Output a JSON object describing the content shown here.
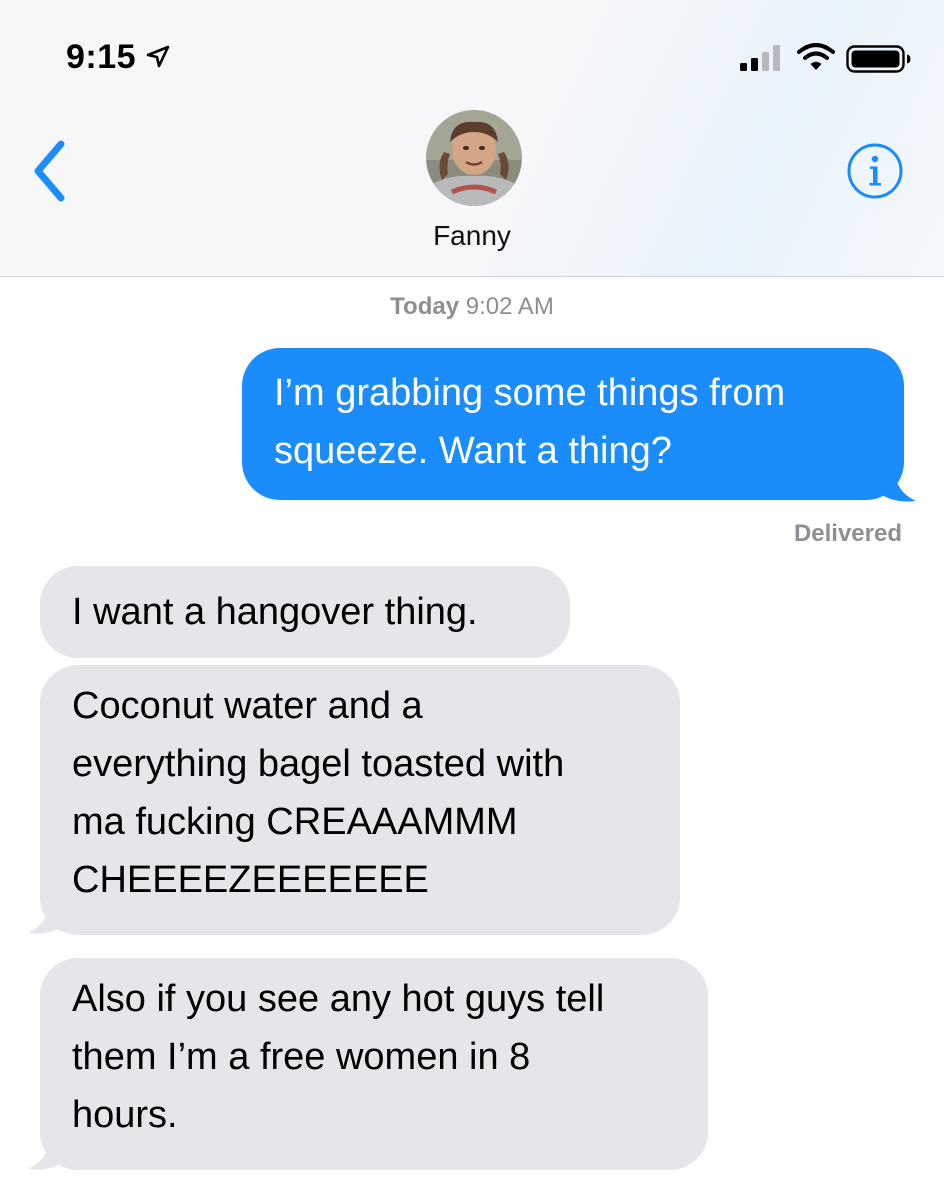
{
  "status_bar": {
    "time": "9:15",
    "location_icon": "location-arrow-icon",
    "signal_icon": "cellular-signal-icon",
    "wifi_icon": "wifi-icon",
    "battery_icon": "battery-icon"
  },
  "nav": {
    "back_icon": "chevron-left-icon",
    "contact_name": "Fanny",
    "avatar_icon": "contact-avatar",
    "info_icon": "info-icon",
    "accent_color": "#1b8cfb"
  },
  "conversation": {
    "timestamp_day": "Today",
    "timestamp_time": "9:02 AM",
    "delivered_label": "Delivered",
    "messages": [
      {
        "direction": "outgoing",
        "lines": [
          "I’m grabbing some things from",
          "squeeze. Want a thing?"
        ]
      },
      {
        "direction": "incoming",
        "lines": [
          "I want a hangover thing."
        ]
      },
      {
        "direction": "incoming",
        "lines": [
          "Coconut water and a",
          "everything bagel toasted with",
          "ma fucking CREAAAMMM",
          "CHEEEEZEEEEEEE"
        ]
      },
      {
        "direction": "incoming",
        "lines": [
          "Also if you see any hot guys tell",
          "them I’m a free women in 8",
          "hours."
        ]
      }
    ],
    "outgoing_color": "#1b8cfb",
    "incoming_color": "#e5e5ea"
  }
}
